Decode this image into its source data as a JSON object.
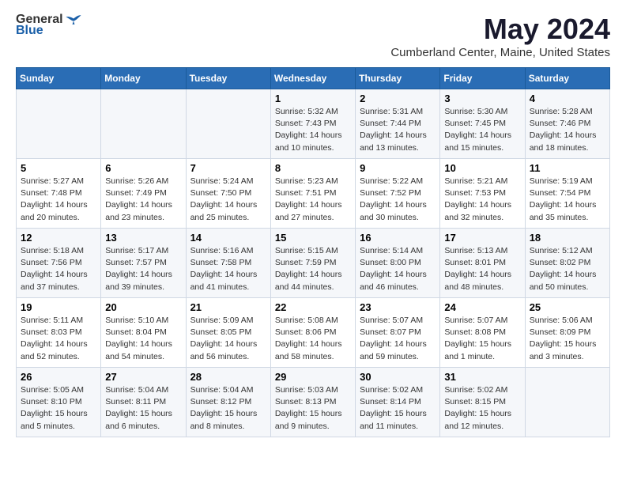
{
  "header": {
    "logo": {
      "text_general": "General",
      "text_blue": "Blue"
    },
    "title": "May 2024",
    "location": "Cumberland Center, Maine, United States"
  },
  "calendar": {
    "days_of_week": [
      "Sunday",
      "Monday",
      "Tuesday",
      "Wednesday",
      "Thursday",
      "Friday",
      "Saturday"
    ],
    "weeks": [
      [
        {
          "day": "",
          "info": ""
        },
        {
          "day": "",
          "info": ""
        },
        {
          "day": "",
          "info": ""
        },
        {
          "day": "1",
          "info": "Sunrise: 5:32 AM\nSunset: 7:43 PM\nDaylight: 14 hours\nand 10 minutes."
        },
        {
          "day": "2",
          "info": "Sunrise: 5:31 AM\nSunset: 7:44 PM\nDaylight: 14 hours\nand 13 minutes."
        },
        {
          "day": "3",
          "info": "Sunrise: 5:30 AM\nSunset: 7:45 PM\nDaylight: 14 hours\nand 15 minutes."
        },
        {
          "day": "4",
          "info": "Sunrise: 5:28 AM\nSunset: 7:46 PM\nDaylight: 14 hours\nand 18 minutes."
        }
      ],
      [
        {
          "day": "5",
          "info": "Sunrise: 5:27 AM\nSunset: 7:48 PM\nDaylight: 14 hours\nand 20 minutes."
        },
        {
          "day": "6",
          "info": "Sunrise: 5:26 AM\nSunset: 7:49 PM\nDaylight: 14 hours\nand 23 minutes."
        },
        {
          "day": "7",
          "info": "Sunrise: 5:24 AM\nSunset: 7:50 PM\nDaylight: 14 hours\nand 25 minutes."
        },
        {
          "day": "8",
          "info": "Sunrise: 5:23 AM\nSunset: 7:51 PM\nDaylight: 14 hours\nand 27 minutes."
        },
        {
          "day": "9",
          "info": "Sunrise: 5:22 AM\nSunset: 7:52 PM\nDaylight: 14 hours\nand 30 minutes."
        },
        {
          "day": "10",
          "info": "Sunrise: 5:21 AM\nSunset: 7:53 PM\nDaylight: 14 hours\nand 32 minutes."
        },
        {
          "day": "11",
          "info": "Sunrise: 5:19 AM\nSunset: 7:54 PM\nDaylight: 14 hours\nand 35 minutes."
        }
      ],
      [
        {
          "day": "12",
          "info": "Sunrise: 5:18 AM\nSunset: 7:56 PM\nDaylight: 14 hours\nand 37 minutes."
        },
        {
          "day": "13",
          "info": "Sunrise: 5:17 AM\nSunset: 7:57 PM\nDaylight: 14 hours\nand 39 minutes."
        },
        {
          "day": "14",
          "info": "Sunrise: 5:16 AM\nSunset: 7:58 PM\nDaylight: 14 hours\nand 41 minutes."
        },
        {
          "day": "15",
          "info": "Sunrise: 5:15 AM\nSunset: 7:59 PM\nDaylight: 14 hours\nand 44 minutes."
        },
        {
          "day": "16",
          "info": "Sunrise: 5:14 AM\nSunset: 8:00 PM\nDaylight: 14 hours\nand 46 minutes."
        },
        {
          "day": "17",
          "info": "Sunrise: 5:13 AM\nSunset: 8:01 PM\nDaylight: 14 hours\nand 48 minutes."
        },
        {
          "day": "18",
          "info": "Sunrise: 5:12 AM\nSunset: 8:02 PM\nDaylight: 14 hours\nand 50 minutes."
        }
      ],
      [
        {
          "day": "19",
          "info": "Sunrise: 5:11 AM\nSunset: 8:03 PM\nDaylight: 14 hours\nand 52 minutes."
        },
        {
          "day": "20",
          "info": "Sunrise: 5:10 AM\nSunset: 8:04 PM\nDaylight: 14 hours\nand 54 minutes."
        },
        {
          "day": "21",
          "info": "Sunrise: 5:09 AM\nSunset: 8:05 PM\nDaylight: 14 hours\nand 56 minutes."
        },
        {
          "day": "22",
          "info": "Sunrise: 5:08 AM\nSunset: 8:06 PM\nDaylight: 14 hours\nand 58 minutes."
        },
        {
          "day": "23",
          "info": "Sunrise: 5:07 AM\nSunset: 8:07 PM\nDaylight: 14 hours\nand 59 minutes."
        },
        {
          "day": "24",
          "info": "Sunrise: 5:07 AM\nSunset: 8:08 PM\nDaylight: 15 hours\nand 1 minute."
        },
        {
          "day": "25",
          "info": "Sunrise: 5:06 AM\nSunset: 8:09 PM\nDaylight: 15 hours\nand 3 minutes."
        }
      ],
      [
        {
          "day": "26",
          "info": "Sunrise: 5:05 AM\nSunset: 8:10 PM\nDaylight: 15 hours\nand 5 minutes."
        },
        {
          "day": "27",
          "info": "Sunrise: 5:04 AM\nSunset: 8:11 PM\nDaylight: 15 hours\nand 6 minutes."
        },
        {
          "day": "28",
          "info": "Sunrise: 5:04 AM\nSunset: 8:12 PM\nDaylight: 15 hours\nand 8 minutes."
        },
        {
          "day": "29",
          "info": "Sunrise: 5:03 AM\nSunset: 8:13 PM\nDaylight: 15 hours\nand 9 minutes."
        },
        {
          "day": "30",
          "info": "Sunrise: 5:02 AM\nSunset: 8:14 PM\nDaylight: 15 hours\nand 11 minutes."
        },
        {
          "day": "31",
          "info": "Sunrise: 5:02 AM\nSunset: 8:15 PM\nDaylight: 15 hours\nand 12 minutes."
        },
        {
          "day": "",
          "info": ""
        }
      ]
    ]
  }
}
